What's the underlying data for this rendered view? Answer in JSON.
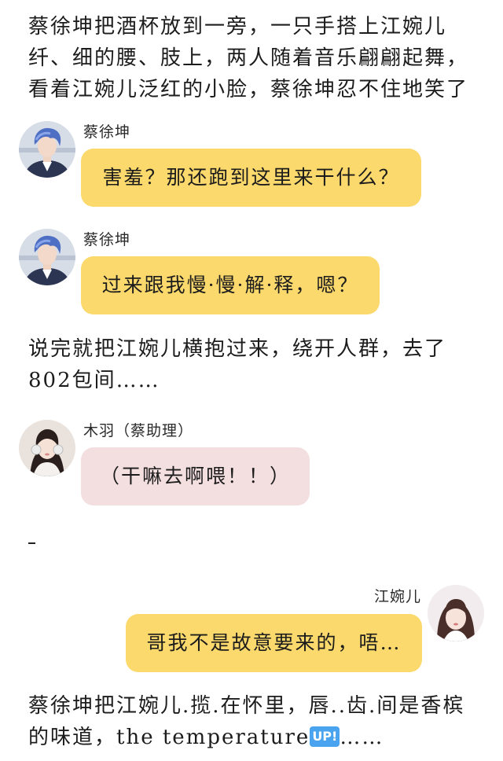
{
  "narration": {
    "intro_line1": "蔡徐坤把酒杯放到一旁，一只手搭上江婉儿",
    "intro_line2": "纤、细的腰、肢上，两人随着音乐翩翩起舞，",
    "intro_line3": "看着江婉儿泛红的小脸，蔡徐坤忍不住地笑了",
    "middle_line1": "说完就把江婉儿横抱过来，绕开人群，去了",
    "middle_line2": "802包间……",
    "ending_line1": "蔡徐坤把江婉儿.揽.在怀里，唇..齿.间是香槟",
    "ending_line2_prefix": "的味道，the temperature",
    "ending_badge": "UP!",
    "ending_line2_suffix": "……"
  },
  "messages": [
    {
      "sender": "蔡徐坤",
      "text": "害羞？那还跑到这里来干什么？",
      "avatar": "blue-hair-boy-avatar",
      "bubble_color": "#fbd96c",
      "side": "left"
    },
    {
      "sender": "蔡徐坤",
      "text": "过来跟我慢·慢·解·释，嗯？",
      "avatar": "blue-hair-boy-avatar",
      "bubble_color": "#fbd96c",
      "side": "left"
    },
    {
      "sender": "木羽（蔡助理）",
      "text": "（干嘛去啊喂！！）",
      "avatar": "girl-with-headphones-avatar",
      "bubble_color": "#f4dfe0",
      "side": "left"
    },
    {
      "sender": "江婉儿",
      "text": "哥我不是故意要来的，唔…",
      "avatar": "girl-with-bangs-avatar",
      "bubble_color": "#fbd96c",
      "side": "right"
    }
  ],
  "colors": {
    "yellow_bubble": "#fbd96c",
    "pink_bubble": "#f4dfe0",
    "up_badge": "#4aa3ef"
  }
}
